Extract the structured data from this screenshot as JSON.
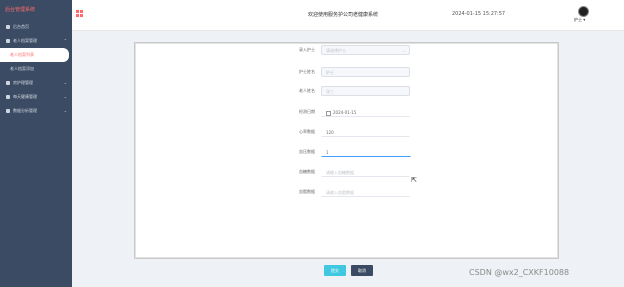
{
  "sidebar": {
    "title": "后台管理系统",
    "items": [
      {
        "label": "后台首页",
        "icon": "home-icon"
      },
      {
        "label": "老人档案管理",
        "icon": "folder-icon"
      },
      {
        "label": "老人档案列表"
      },
      {
        "label": "老人档案添加"
      },
      {
        "label": "房护理管理",
        "icon": "bed-icon"
      },
      {
        "label": "每天健康管理",
        "icon": "heart-icon"
      },
      {
        "label": "数据分析管理",
        "icon": "chart-icon"
      }
    ]
  },
  "header": {
    "title": "欢迎使用服务护公司老健康系统",
    "datetime": "2024-01-15 15:27:57",
    "user": "护士 ▾"
  },
  "form": {
    "fields": [
      {
        "label": "录入护士",
        "value": "",
        "placeholder": "请选择护士"
      },
      {
        "label": "护士姓名",
        "value": "",
        "placeholder": "护士"
      },
      {
        "label": "老人姓名",
        "value": "",
        "placeholder": "张三"
      },
      {
        "label": "检测日期",
        "value": "2024-01-15"
      },
      {
        "label": "心率数据",
        "value": "120"
      },
      {
        "label": "血压数据",
        "value": "1"
      },
      {
        "label": "血糖数据",
        "value": "",
        "placeholder": "请输入血糖数据"
      },
      {
        "label": "血脂数据",
        "value": "",
        "placeholder": "请输入血脂数据"
      }
    ]
  },
  "buttons": {
    "submit": "提交",
    "cancel": "取消"
  },
  "watermark": "CSDN @wx2_CXKF10088",
  "colors": {
    "sidebar_bg": "#3b4b63",
    "accent": "#ff6b6b",
    "submit_bg": "#3fc8e0",
    "focus_line": "#409eff"
  }
}
